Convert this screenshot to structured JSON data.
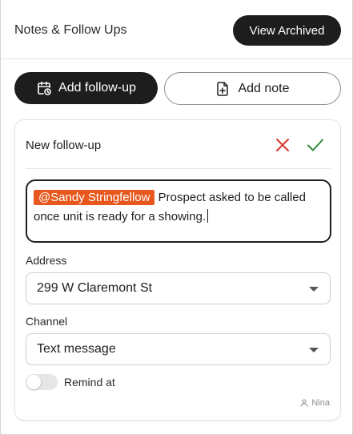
{
  "header": {
    "title": "Notes & Follow Ups",
    "view_archived_label": "View Archived"
  },
  "actions": {
    "add_followup_label": "Add follow-up",
    "add_note_label": "Add note"
  },
  "followup_form": {
    "title": "New follow-up",
    "editor": {
      "mention": "@Sandy Stringfellow",
      "text": " Prospect asked to be called once unit is ready for a showing."
    },
    "address": {
      "label": "Address",
      "value": "299 W Claremont St"
    },
    "channel": {
      "label": "Channel",
      "value": "Text message"
    },
    "remind": {
      "label": "Remind at",
      "enabled": false
    },
    "author": "Nina"
  },
  "colors": {
    "primary_dark": "#1d1d1d",
    "mention_orange": "#e8571c",
    "cancel_red": "#d93a2b",
    "confirm_green": "#2f8a3c"
  },
  "icons": {
    "add_followup": "calendar-clock-icon",
    "add_note": "file-plus-icon",
    "cancel": "close-icon",
    "confirm": "check-icon",
    "author": "user-icon",
    "dropdown": "chevron-down-icon"
  }
}
